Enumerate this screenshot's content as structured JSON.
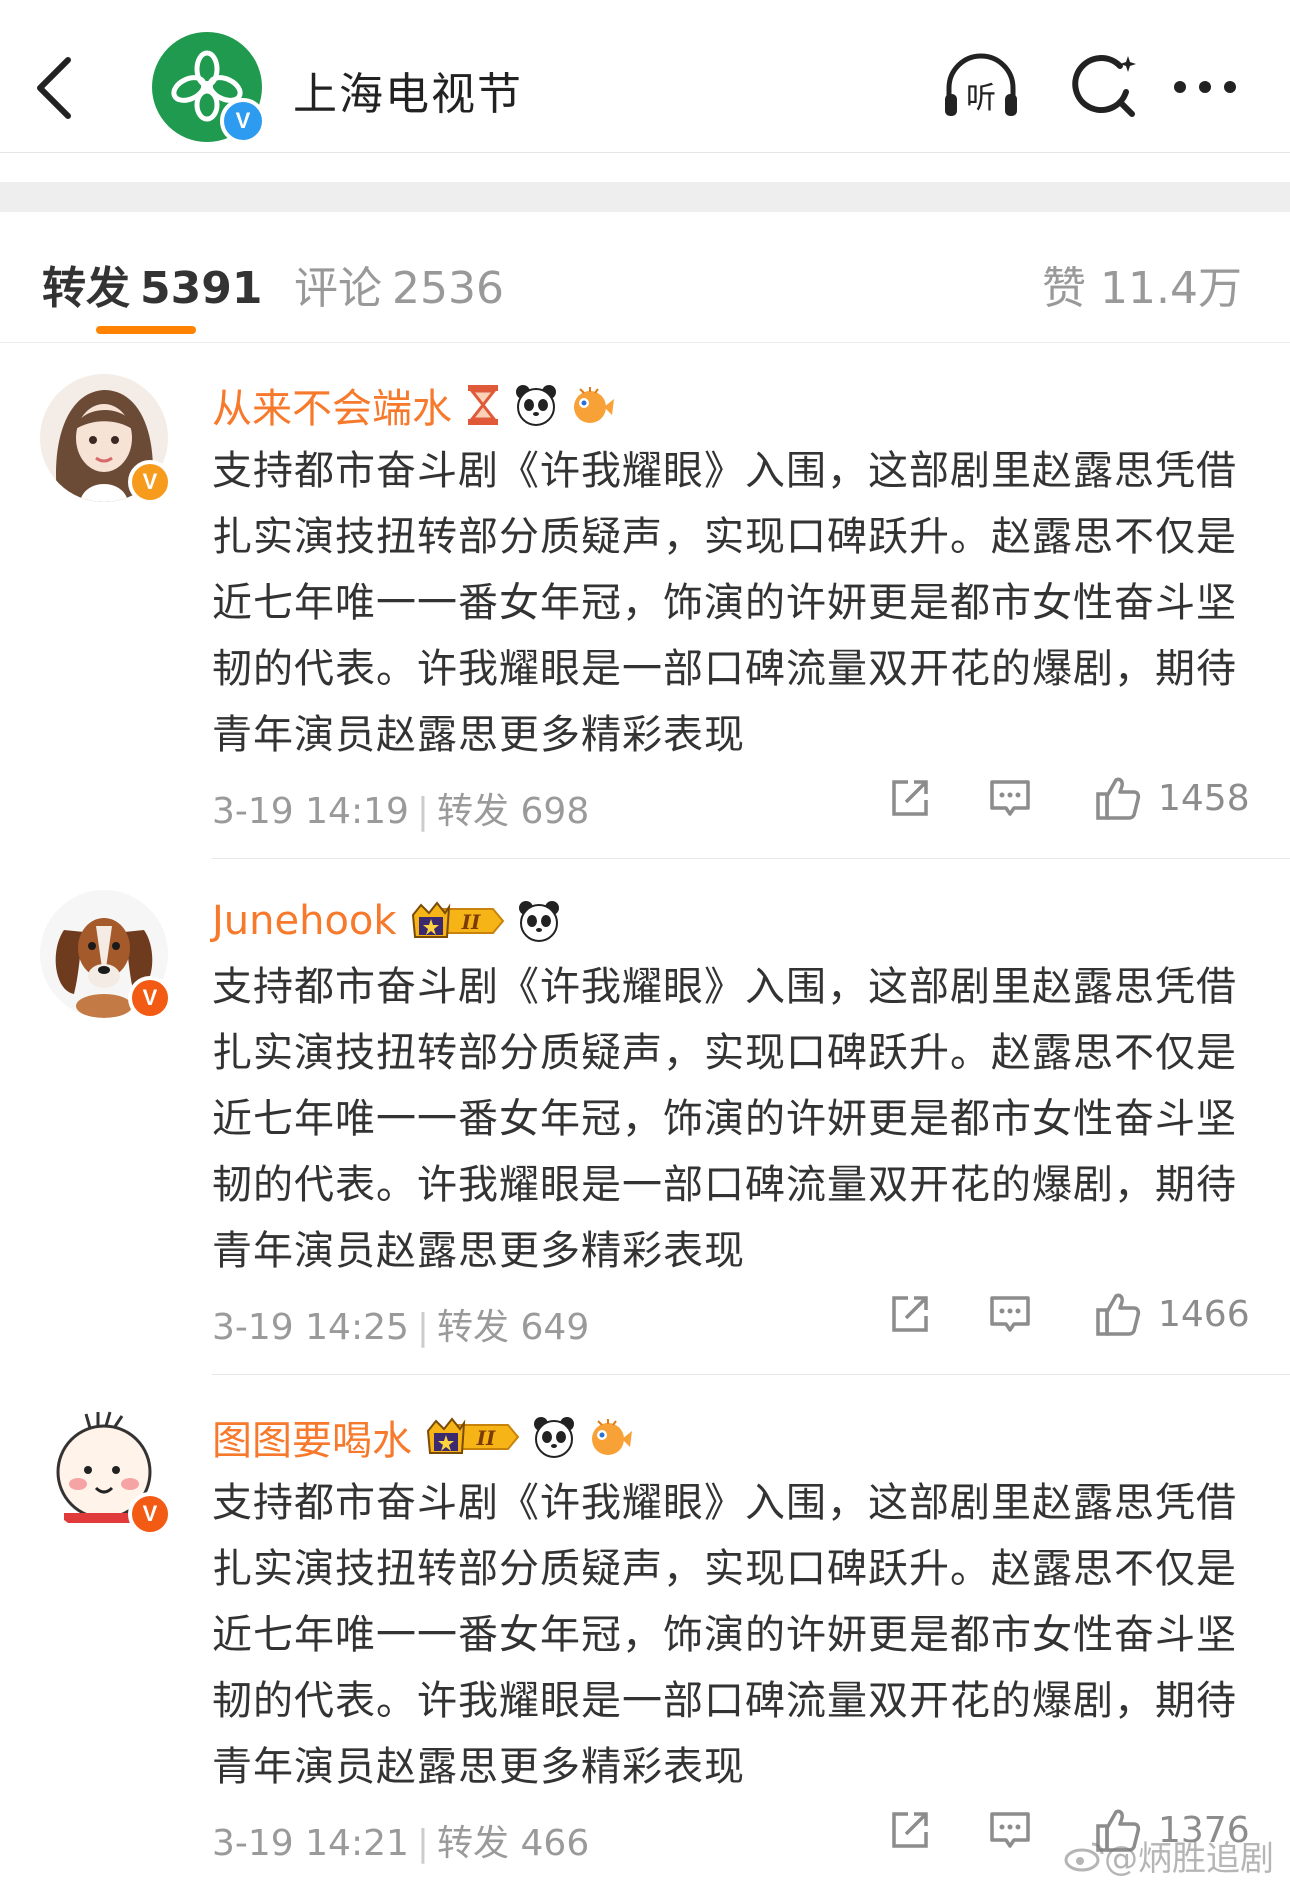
{
  "header": {
    "title": "上海电视节",
    "verified_mark": "V",
    "listen_label": "听"
  },
  "tabs": {
    "repost_label": "转发",
    "repost_count": "5391",
    "comment_label": "评论",
    "comment_count": "2536",
    "like_label": "赞",
    "like_count": "11.4万"
  },
  "comments": [
    {
      "name": "从来不会端水",
      "badges": [
        "hourglass-icon",
        "panda-icon",
        "pufferfish-icon"
      ],
      "text": "支持都市奋斗剧《许我耀眼》入围，这部剧里赵露思凭借扎实演技扭转部分质疑声，实现口碑跃升。赵露思不仅是近七年唯一一番女年冠，饰演的许妍更是都市女性奋斗坚韧的代表。许我耀眼是一部口碑流量双开花的爆剧，期待青年演员赵露思更多精彩表现",
      "time": "3-19 14:19",
      "repost_label": "转发",
      "reposts": "698",
      "likes": "1458"
    },
    {
      "name": "Junehook",
      "badges": [
        "crown-level-badge",
        "panda-icon"
      ],
      "text": "支持都市奋斗剧《许我耀眼》入围，这部剧里赵露思凭借扎实演技扭转部分质疑声，实现口碑跃升。赵露思不仅是近七年唯一一番女年冠，饰演的许妍更是都市女性奋斗坚韧的代表。许我耀眼是一部口碑流量双开花的爆剧，期待青年演员赵露思更多精彩表现",
      "time": "3-19 14:25",
      "repost_label": "转发",
      "reposts": "649",
      "likes": "1466"
    },
    {
      "name": "图图要喝水",
      "badges": [
        "crown-level-badge",
        "panda-icon",
        "pufferfish-icon"
      ],
      "text": "支持都市奋斗剧《许我耀眼》入围，这部剧里赵露思凭借扎实演技扭转部分质疑声，实现口碑跃升。赵露思不仅是近七年唯一一番女年冠，饰演的许妍更是都市女性奋斗坚韧的代表。许我耀眼是一部口碑流量双开花的爆剧，期待青年演员赵露思更多精彩表现",
      "time": "3-19 14:21",
      "repost_label": "转发",
      "reposts": "466",
      "likes": "1376"
    }
  ],
  "badge_text": {
    "level": "II",
    "verified": "V"
  },
  "watermark": "@炳胜追剧",
  "colors": {
    "accent": "#ff8200",
    "username": "#f7792b",
    "brand_green": "#1f9a4f",
    "verified_blue": "#2d9cf0",
    "verified_orange": "#f79b1c"
  }
}
